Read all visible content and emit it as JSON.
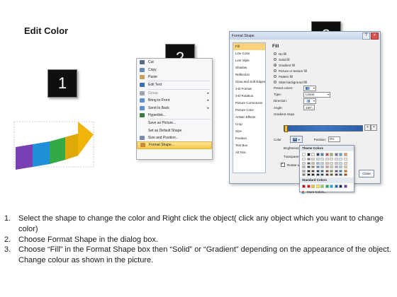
{
  "page": {
    "title": "Edit Color"
  },
  "steps": [
    {
      "number": "1"
    },
    {
      "number": "2"
    },
    {
      "number": "3"
    }
  ],
  "context_menu": {
    "items": [
      {
        "label": "Cut",
        "icon": "scissors-icon",
        "icon_color": "#5a6b8a"
      },
      {
        "label": "Copy",
        "icon": "copy-icon",
        "icon_color": "#6a8ab5"
      },
      {
        "label": "Paste",
        "icon": "paste-icon",
        "icon_color": "#c9a25a"
      },
      {
        "label": "Edit Text",
        "icon": "edit-text-icon",
        "icon_color": "#3d6fb0"
      },
      {
        "label": "Group",
        "icon": "group-icon",
        "icon_color": "#9aa3b0",
        "submenu": true
      },
      {
        "label": "Bring to Front",
        "icon": "bring-front-icon",
        "icon_color": "#5b8fd0",
        "submenu": true
      },
      {
        "label": "Send to Back",
        "icon": "send-back-icon",
        "icon_color": "#5b8fd0",
        "submenu": true
      },
      {
        "label": "Hyperlink...",
        "icon": "hyperlink-icon",
        "icon_color": "#3d7a3d"
      },
      {
        "label": "Save as Picture...",
        "icon": "none",
        "icon_color": "transparent"
      },
      {
        "label": "Set as Default Shape",
        "icon": "none",
        "icon_color": "transparent"
      },
      {
        "label": "Size and Position...",
        "icon": "size-icon",
        "icon_color": "#7a8aa5"
      },
      {
        "label": "Format Shape...",
        "icon": "format-shape-icon",
        "icon_color": "#c98a3a",
        "highlighted": true
      }
    ]
  },
  "dialog": {
    "title": "Format Shape",
    "categories": [
      "Fill",
      "Line Color",
      "Line Style",
      "Shadow",
      "Reflection",
      "Glow and Soft Edges",
      "3-D Format",
      "3-D Rotation",
      "Picture Corrections",
      "Picture Color",
      "Artistic Effects",
      "Crop",
      "Size",
      "Position",
      "Text Box",
      "Alt Text"
    ],
    "selected_category": "Fill",
    "panel_heading": "Fill",
    "fill_options": [
      {
        "label": "No fill",
        "selected": false
      },
      {
        "label": "Solid fill",
        "selected": false
      },
      {
        "label": "Gradient fill",
        "selected": true
      },
      {
        "label": "Picture or texture fill",
        "selected": false
      },
      {
        "label": "Pattern fill",
        "selected": false
      },
      {
        "label": "Slide background fill",
        "selected": false
      }
    ],
    "preset_label": "Preset colors:",
    "type_label": "Type:",
    "type_value": "Linear",
    "direction_label": "Direction:",
    "angle_label": "Angle:",
    "angle_value": "180°",
    "gradient_stops_label": "Gradient stops",
    "color_label": "Color",
    "position_label": "Position:",
    "position_value": "0%",
    "brightness_label": "Brightness:",
    "transparency_label": "Transparency:",
    "rotate_label": "Rotate with shape",
    "close_label": "Close"
  },
  "color_picker": {
    "theme_label": "Theme Colors",
    "standard_label": "Standard Colors",
    "more_label": "More Colors...",
    "theme_top": [
      "#ffffff",
      "#000000",
      "#eeece1",
      "#1f497d",
      "#4f81bd",
      "#c0504d",
      "#9bbb59",
      "#8064a2",
      "#4bacc6",
      "#f79646"
    ],
    "theme_shades": [
      [
        "#f2f2f2",
        "#7f7f7f",
        "#ddd9c3",
        "#c6d9f0",
        "#dbe5f1",
        "#f2dcdb",
        "#ebf1dd",
        "#e5e0ec",
        "#dbeef3",
        "#fdeada"
      ],
      [
        "#d8d8d8",
        "#595959",
        "#c4bd97",
        "#8db3e2",
        "#b8cce4",
        "#e5b9b7",
        "#d7e3bc",
        "#ccc1d9",
        "#b7dde8",
        "#fbd5b5"
      ],
      [
        "#bfbfbf",
        "#3f3f3f",
        "#938953",
        "#548dd4",
        "#95b3d7",
        "#d99694",
        "#c3d69b",
        "#b2a2c7",
        "#92cddc",
        "#fac08f"
      ],
      [
        "#a5a5a5",
        "#262626",
        "#494429",
        "#17365d",
        "#366092",
        "#953734",
        "#76923c",
        "#5f497a",
        "#31859b",
        "#e36c09"
      ],
      [
        "#7f7f7f",
        "#0c0c0c",
        "#1d1b10",
        "#0f243e",
        "#244061",
        "#632423",
        "#4f6128",
        "#3f3151",
        "#205867",
        "#974806"
      ]
    ],
    "standard": [
      "#c00000",
      "#ff0000",
      "#ffc000",
      "#ffff00",
      "#92d050",
      "#00b050",
      "#00b0f0",
      "#0070c0",
      "#002060",
      "#7030a0"
    ]
  },
  "instructions": [
    {
      "num": "1.",
      "text": "Select the shape to change the color and Right click the object( click any object which you want to change color)"
    },
    {
      "num": "2.",
      "text": "Choose Format Shape in the dialog box."
    },
    {
      "num": "3.",
      "text": "Choose “Fill” in the Format Shape box then “Solid” or “Gradient” depending on the appearance of the object. Change colour as shown in the picture."
    }
  ]
}
